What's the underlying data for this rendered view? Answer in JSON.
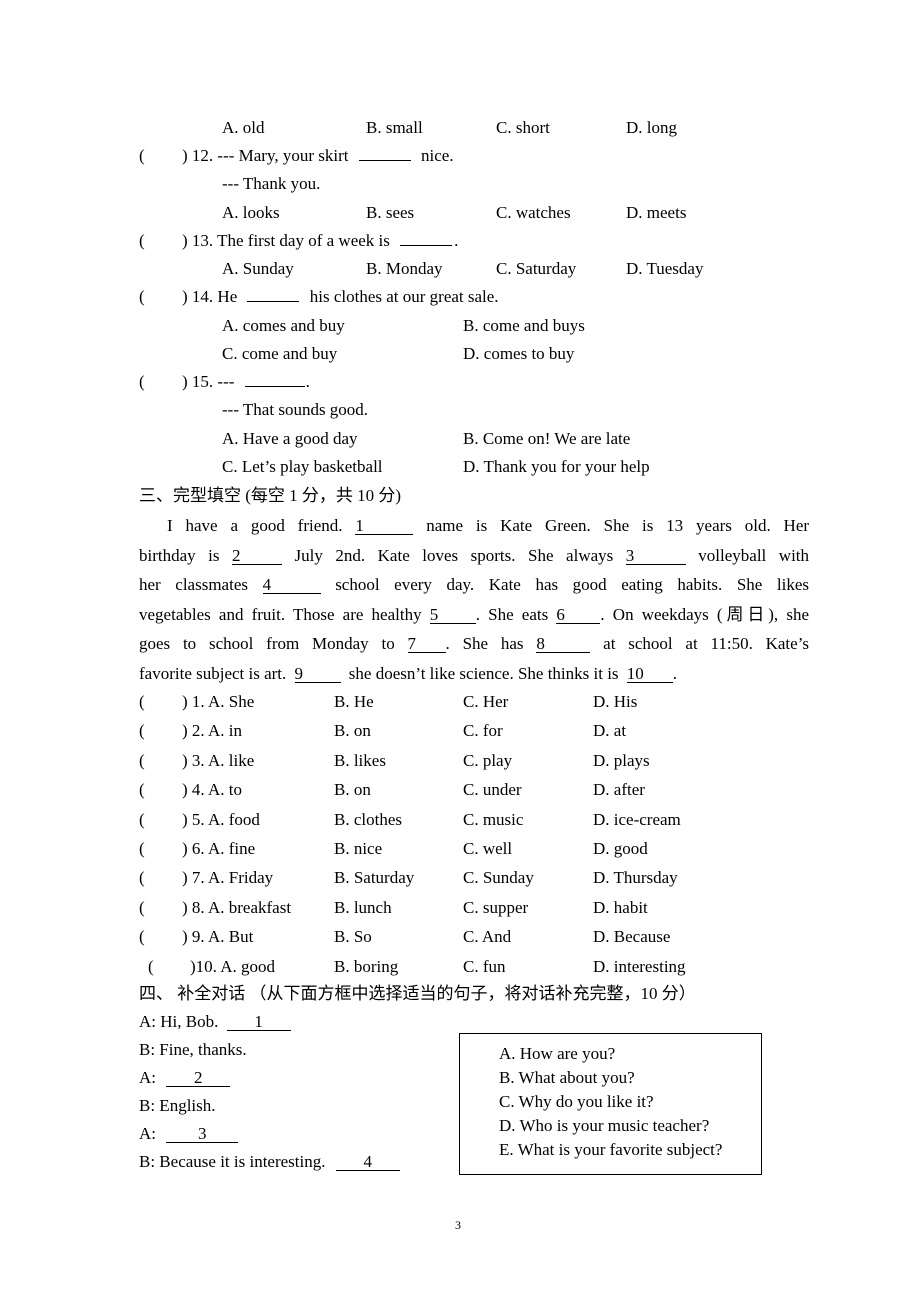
{
  "section2_continued": {
    "q11_options": [
      "A. old",
      "B. small",
      "C. short",
      "D. long"
    ],
    "q12": {
      "paren": "(",
      "close": ") 12. --- Mary, your skirt",
      "after": "nice.",
      "reply": "--- Thank you.",
      "options": [
        "A. looks",
        "B. sees",
        "C. watches",
        "D. meets"
      ]
    },
    "q13": {
      "paren": "(",
      "close": ") 13. The first day of a week is",
      "after": ".",
      "options": [
        "A. Sunday",
        "B. Monday",
        "C. Saturday",
        "D. Tuesday"
      ]
    },
    "q14": {
      "paren": "(",
      "close": ") 14. He",
      "after": "his clothes at our great sale.",
      "options": [
        "A. comes and buy",
        "B. come and buys",
        "C. come and buy",
        "D. comes to buy"
      ]
    },
    "q15": {
      "paren": "(",
      "close": ") 15. ---",
      "after": ".",
      "reply": "--- That sounds good.",
      "options": [
        "A. Have a good day",
        "B. Come on! We are late",
        "C. Let’s play basketball",
        "D. Thank you for your help"
      ]
    }
  },
  "section3": {
    "heading": "三、完型填空  (每空 1 分，共 10 分)",
    "passage_lines": [
      [
        "I have a good friend.",
        "1",
        "name is Kate Green. She is 13 years old. Her"
      ],
      [
        "birthday is",
        "2",
        "July 2nd. Kate loves sports. She always",
        "3",
        "volleyball with"
      ],
      [
        "her classmates",
        "4",
        "school every day. Kate has good eating habits. She likes"
      ],
      [
        "vegetables and fruit. Those are healthy",
        "5",
        ". She eats",
        "6",
        ". On weekdays (周日), she"
      ],
      [
        "goes to school from Monday to",
        "7",
        ". She has",
        "8",
        "at school at 11:50. Kate’s"
      ],
      [
        "favorite subject is art.",
        "9",
        "she doesn’t like science. She thinks it is",
        "10",
        "."
      ]
    ],
    "questions": [
      {
        "label": ") 1. A. She",
        "b": "B. He",
        "c": "C. Her",
        "d": "D. His"
      },
      {
        "label": ") 2. A. in",
        "b": "B. on",
        "c": "C. for",
        "d": "D. at"
      },
      {
        "label": ") 3. A. like",
        "b": "B. likes",
        "c": "C. play",
        "d": "D. plays"
      },
      {
        "label": ") 4. A. to",
        "b": "B. on",
        "c": "C. under",
        "d": "D. after"
      },
      {
        "label": ") 5. A. food",
        "b": "B. clothes",
        "c": "C. music",
        "d": "D. ice-cream"
      },
      {
        "label": ") 6. A. fine",
        "b": "B. nice",
        "c": "C. well",
        "d": "D. good"
      },
      {
        "label": ") 7. A. Friday",
        "b": "B. Saturday",
        "c": "C. Sunday",
        "d": "D. Thursday"
      },
      {
        "label": ") 8. A. breakfast",
        "b": "B. lunch",
        "c": "C. supper",
        "d": "D. habit"
      },
      {
        "label": ") 9. A. But",
        "b": "B. So",
        "c": "C. And",
        "d": "D. Because"
      },
      {
        "label": ")10. A. good",
        "b": "B. boring",
        "c": "C. fun",
        "d": "D. interesting"
      }
    ]
  },
  "section4": {
    "heading": "四、  补全对话 （从下面方框中选择适当的句子，将对话补充完整，10 分）",
    "dialogue": [
      {
        "text": "A: Hi, Bob.",
        "blank": "1"
      },
      {
        "text": "B: Fine, thanks.",
        "blank": null
      },
      {
        "text": "A:",
        "blank": "2"
      },
      {
        "text": "B: English.",
        "blank": null
      },
      {
        "text": "A:",
        "blank": "3"
      },
      {
        "text": "B: Because it is interesting.",
        "blank": "4"
      }
    ],
    "box_options": [
      "A. How are you?",
      "B. What about you?",
      "C. Why do you like it?",
      "D. Who is your music teacher?",
      "E. What is your favorite subject?"
    ]
  },
  "page_number": "3"
}
